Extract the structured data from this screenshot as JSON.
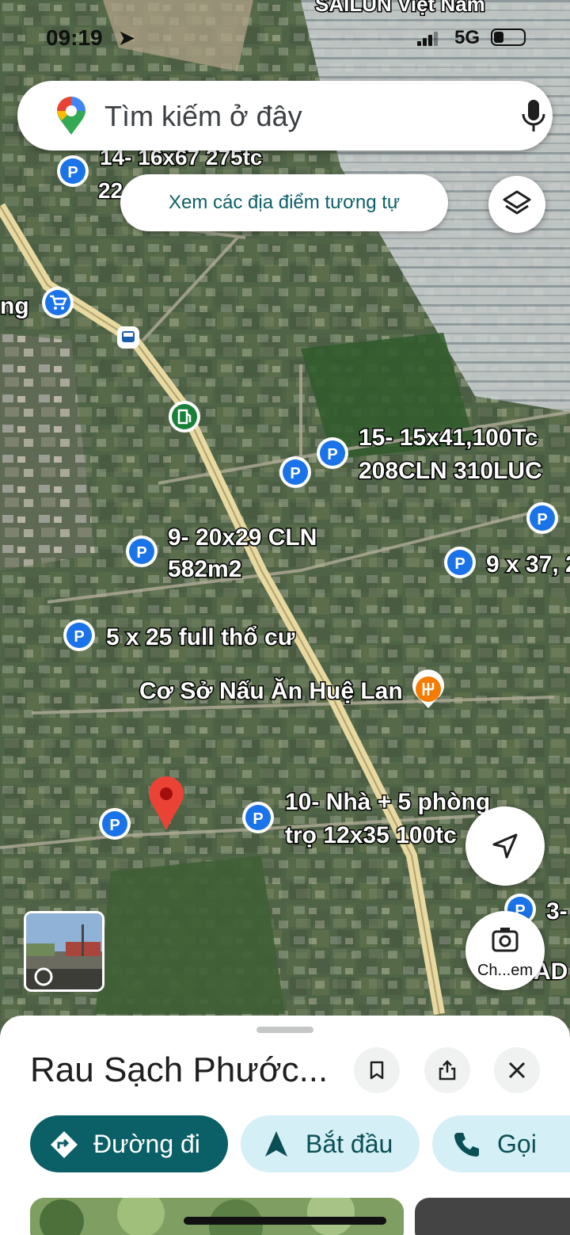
{
  "status_bar": {
    "time": "09:19",
    "network": "5G"
  },
  "map": {
    "top_label": "SAILUN Việt Nam",
    "labels": [
      {
        "id": "l14a",
        "text": "14- 16x67 275tc"
      },
      {
        "id": "l14b",
        "text": "22"
      },
      {
        "id": "lng",
        "text": "ng"
      },
      {
        "id": "l15a",
        "text": "15- 15x41,100Tc"
      },
      {
        "id": "l15b",
        "text": "208CLN 310LUC"
      },
      {
        "id": "l9a",
        "text": "9- 20x29 CLN"
      },
      {
        "id": "l9b",
        "text": "582m2"
      },
      {
        "id": "l937",
        "text": "9 x 37, 2"
      },
      {
        "id": "l525",
        "text": "5 x 25 full thổ cư"
      },
      {
        "id": "lhue",
        "text": "Cơ Sở Nấu Ăn Huệ Lan"
      },
      {
        "id": "l10a",
        "text": "10- Nhà + 5 phòng"
      },
      {
        "id": "l10b",
        "text": "trọ 12x35 100tc"
      },
      {
        "id": "l3",
        "text": "3-"
      },
      {
        "id": "lad",
        "text": "AD"
      }
    ]
  },
  "search": {
    "placeholder": "Tìm kiếm ở đây"
  },
  "chip": {
    "label": "Xem các địa điểm tương tự"
  },
  "camera_button": {
    "label": "Ch...em"
  },
  "sheet": {
    "title": "Rau Sạch Phước...",
    "actions": {
      "directions": "Đường đi",
      "start": "Bắt đầu",
      "call": "Gọi"
    }
  },
  "colors": {
    "accent": "#0b5f66",
    "pill_light": "#d4eff5",
    "pin_blue": "#1a73e8",
    "pin_red": "#ea4335",
    "food_orange": "#f57c00",
    "gas_green": "#188038",
    "road": "#e8d9a0"
  }
}
